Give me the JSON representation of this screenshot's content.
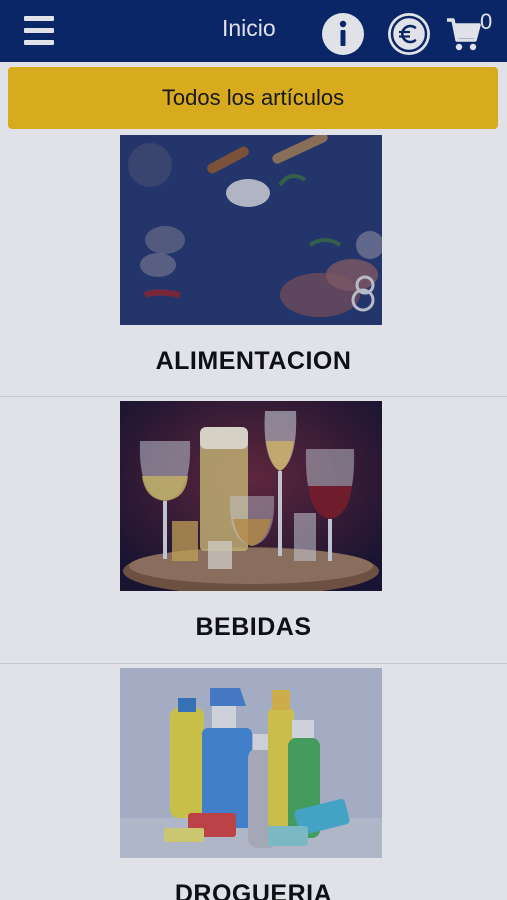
{
  "header": {
    "title": "Inicio",
    "menu_icon": "hamburger-menu-icon",
    "info_icon": "info-icon",
    "currency_icon": "euro-icon",
    "cart_icon": "shopping-cart-icon",
    "cart_count": "0",
    "background_color": "#0b2a6e"
  },
  "all_items_button": {
    "label": "Todos los artículos",
    "color": "#f5c01a"
  },
  "categories": [
    {
      "label": "ALIMENTACION",
      "image": "food-spices-photo"
    },
    {
      "label": "BEBIDAS",
      "image": "drinks-glasses-photo"
    },
    {
      "label": "DROGUERIA",
      "image": "cleaning-products-photo"
    }
  ]
}
